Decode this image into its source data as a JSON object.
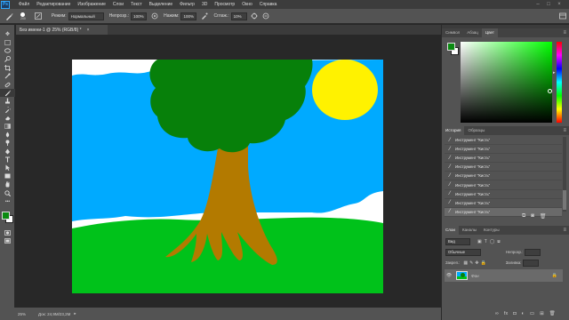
{
  "app": {
    "logo": "Ps"
  },
  "menu": [
    "Файл",
    "Редактирование",
    "Изображение",
    "Слои",
    "Текст",
    "Выделение",
    "Фильтр",
    "3D",
    "Просмотр",
    "Окно",
    "Справка"
  ],
  "window_controls": [
    "–",
    "□",
    "×"
  ],
  "options": {
    "brush_size": "200",
    "mode_label": "Режим:",
    "mode_value": "Нормальный",
    "opacity_label": "Непрозр.:",
    "opacity_value": "100%",
    "pressure_label": "Нажим:",
    "pressure_value": "100%",
    "smoothing_label": "Сглаж.:",
    "smoothing_value": "10%"
  },
  "document": {
    "tab_title": "Без имени-1 @ 25% (RGB/8) *",
    "zoom": "25%",
    "doc_info": "Док: 24,9М/23,2М"
  },
  "tools": [
    "move-tool",
    "marquee-tool",
    "lasso-tool",
    "quick-select-tool",
    "crop-tool",
    "eyedropper-tool",
    "healing-tool",
    "brush-tool",
    "stamp-tool",
    "history-brush-tool",
    "eraser-tool",
    "gradient-tool",
    "blur-tool",
    "dodge-tool",
    "pen-tool",
    "type-tool",
    "path-select-tool",
    "shape-tool",
    "hand-tool",
    "zoom-tool"
  ],
  "colors": {
    "foreground": "#0a8a10",
    "background": "#ffffff",
    "sky": "#00aaff",
    "grass": "#00c21a",
    "trunk": "#b37a00",
    "foliage": "#07800a",
    "sun": "#fff200",
    "accent": "#31a8ff"
  },
  "color_panel": {
    "tabs": [
      "Символ",
      "Абзац",
      "Цвет"
    ],
    "active_tab": "Цвет"
  },
  "history_panel": {
    "tabs": [
      "История",
      "Образцы"
    ],
    "active_tab": "История",
    "items": [
      "Инструмент \"Кисть\"",
      "Инструмент \"Кисть\"",
      "Инструмент \"Кисть\"",
      "Инструмент \"Кисть\"",
      "Инструмент \"Кисть\"",
      "Инструмент \"Кисть\"",
      "Инструмент \"Кисть\"",
      "Инструмент \"Кисть\"",
      "Инструмент \"Кисть\""
    ],
    "selected_index": 8
  },
  "layers_panel": {
    "tabs": [
      "Слои",
      "Каналы",
      "Контуры"
    ],
    "active_tab": "Слои",
    "kind_label": "Вид",
    "blend_mode": "Обычные",
    "opacity_label": "Непрозр.:",
    "lock_label": "Закреп.:",
    "fill_label": "Заливка:",
    "layers": [
      {
        "name": "Фон",
        "visible": true
      }
    ]
  }
}
